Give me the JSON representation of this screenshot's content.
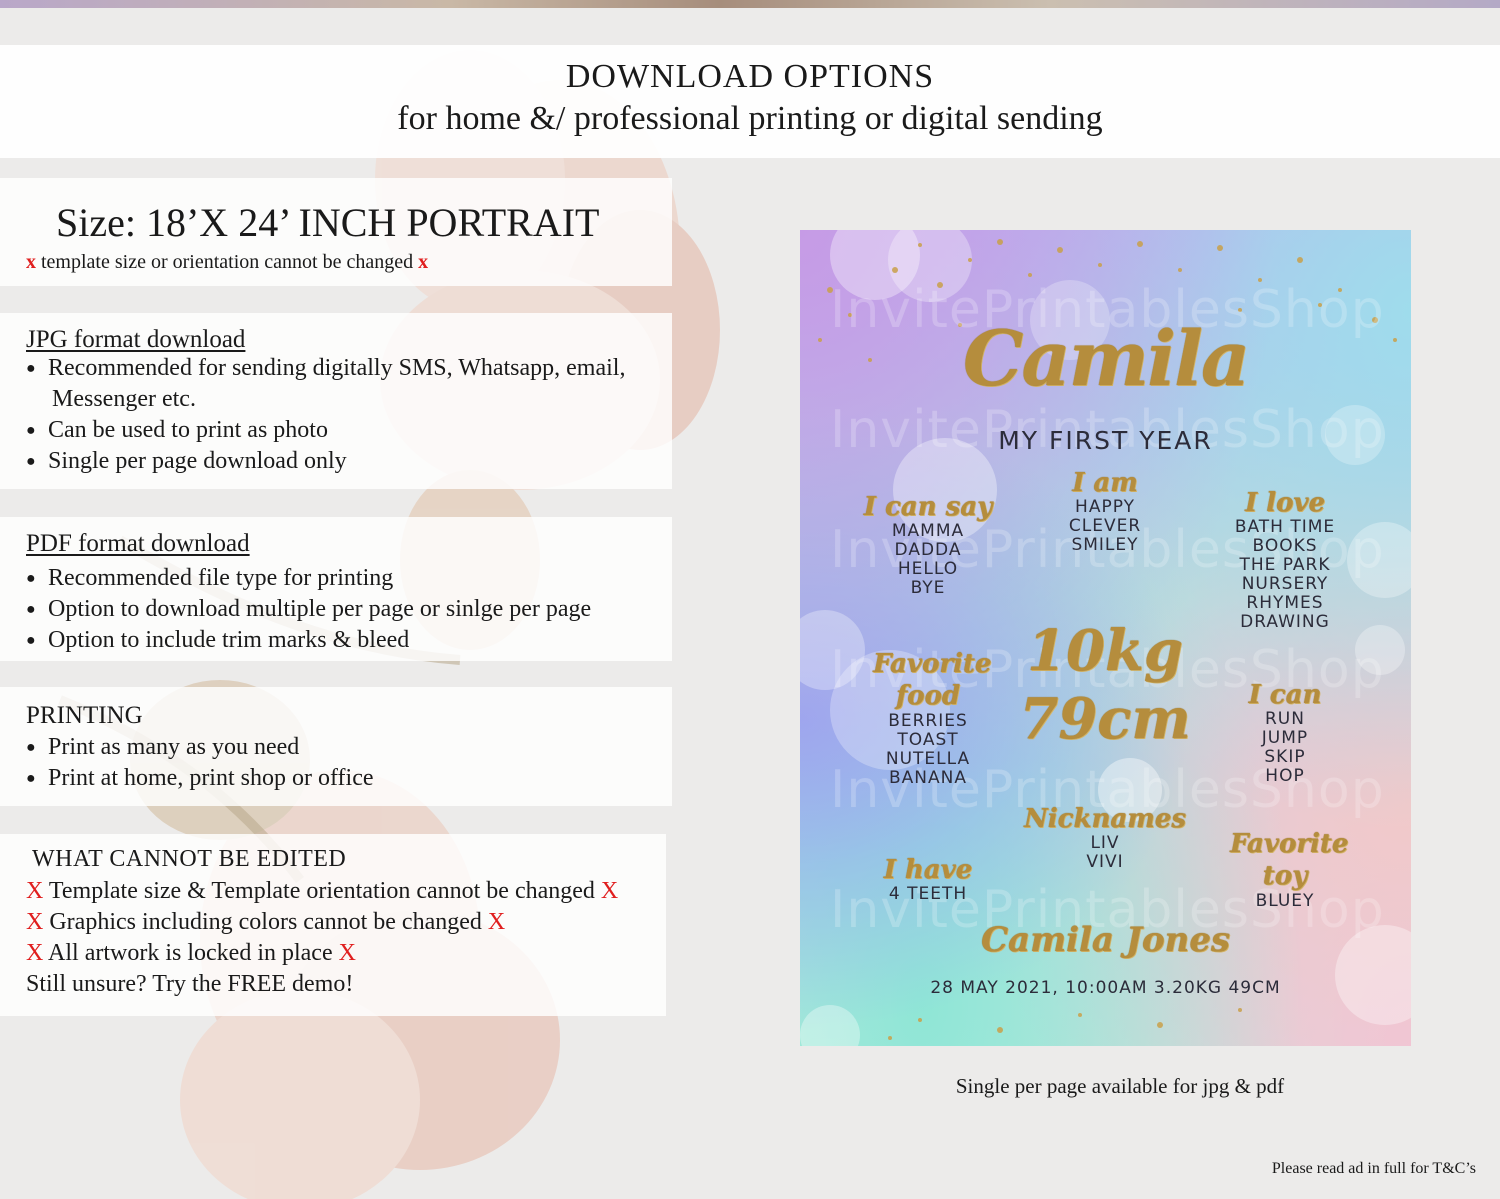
{
  "header": {
    "title": "DOWNLOAD OPTIONS",
    "subtitle": "for home &/ professional printing or digital sending"
  },
  "size": {
    "title": "Size: 18’X 24’ INCH PORTRAIT",
    "mark": "x",
    "note": "template size or orientation cannot be changed"
  },
  "jpg": {
    "title": "JPG format download",
    "bullets": [
      "Recommended for sending digitally SMS, Whatsapp, email,",
      "Can be used to print as photo",
      "Single per page download only"
    ],
    "continuation": "Messenger etc."
  },
  "pdf": {
    "title": "PDF format download",
    "bullets": [
      "Recommended file type for printing",
      "Option to download multiple per page or sinlge per page",
      "Option to include trim marks & bleed"
    ]
  },
  "printing": {
    "title": "PRINTING",
    "bullets": [
      "Print as many as you need",
      "Print at home, print shop or office"
    ]
  },
  "edit": {
    "title": "WHAT CANNOT BE EDITED",
    "mark": "X",
    "lines": [
      "Template size & Template orientation cannot be changed",
      "Graphics including colors cannot be changed",
      "All artwork is locked in place"
    ],
    "closing": "Still unsure? Try the FREE demo!"
  },
  "poster": {
    "name": "Camila",
    "subtitle": "MY FIRST YEAR",
    "blocks": {
      "can_say": {
        "heading": "I can say",
        "items": [
          "MAMMA",
          "DADDA",
          "HELLO",
          "BYE"
        ]
      },
      "i_am": {
        "heading": "I am",
        "items": [
          "HAPPY",
          "CLEVER",
          "SMILEY"
        ]
      },
      "i_love": {
        "heading": "I love",
        "items": [
          "BATH TIME",
          "BOOKS",
          "THE PARK",
          "NURSERY",
          "RHYMES",
          "DRAWING"
        ]
      },
      "food": {
        "heading": "Favorite food",
        "items": [
          "BERRIES",
          "TOAST",
          "NUTELLA",
          "BANANA"
        ]
      },
      "i_can": {
        "heading": "I can",
        "items": [
          "RUN",
          "JUMP",
          "SKIP",
          "HOP"
        ]
      },
      "nicknames": {
        "heading": "Nicknames",
        "items": [
          "LIV",
          "VIVI"
        ]
      },
      "i_have": {
        "heading": "I have",
        "items": [
          "4 TEETH"
        ]
      },
      "toy": {
        "heading": "Favorite toy",
        "items": [
          "BLUEY"
        ]
      }
    },
    "weight": "10kg",
    "height": "79cm",
    "full_name": "Camila Jones",
    "birth_info": "28 MAY 2021, 10:00AM 3.20KG 49CM",
    "watermark": "InvitePrintablesShop",
    "colors": {
      "gold": "#b58d3d",
      "text": "#2c2c3a"
    }
  },
  "caption": "Single per page available for jpg & pdf",
  "terms": "Please read ad in full for T&C’s",
  "colors": {
    "red_mark": "#e01e1e"
  }
}
